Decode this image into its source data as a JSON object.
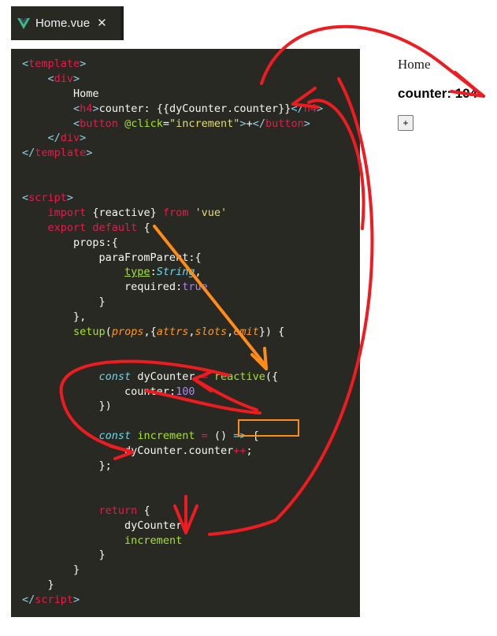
{
  "editor": {
    "tab": {
      "icon": "vue-logo-icon",
      "filename": "Home.vue",
      "close_glyph": "✕"
    },
    "background": "#282923",
    "code_lines": [
      {
        "id": "l1",
        "segments": [
          {
            "t": "<",
            "c": "pun-ang"
          },
          {
            "t": "template",
            "c": "tag"
          },
          {
            "t": ">",
            "c": "pun-ang"
          }
        ]
      },
      {
        "id": "l2",
        "segments": [
          {
            "t": "    ",
            "c": "plain"
          },
          {
            "t": "<",
            "c": "pun-ang"
          },
          {
            "t": "div",
            "c": "tag"
          },
          {
            "t": ">",
            "c": "pun-ang"
          }
        ]
      },
      {
        "id": "l3",
        "segments": [
          {
            "t": "        Home",
            "c": "plain"
          }
        ]
      },
      {
        "id": "l4",
        "segments": [
          {
            "t": "        ",
            "c": "plain"
          },
          {
            "t": "<",
            "c": "pun-ang"
          },
          {
            "t": "h4",
            "c": "tag"
          },
          {
            "t": ">",
            "c": "pun-ang"
          },
          {
            "t": "counter: {{dyCounter.counter}}",
            "c": "plain"
          },
          {
            "t": "</",
            "c": "pun-ang"
          },
          {
            "t": "h4",
            "c": "tag"
          },
          {
            "t": ">",
            "c": "pun-ang"
          }
        ]
      },
      {
        "id": "l5",
        "segments": [
          {
            "t": "        ",
            "c": "plain"
          },
          {
            "t": "<",
            "c": "pun-ang"
          },
          {
            "t": "button",
            "c": "tag"
          },
          {
            "t": " ",
            "c": "plain"
          },
          {
            "t": "@click",
            "c": "attr"
          },
          {
            "t": "=",
            "c": "plain"
          },
          {
            "t": "\"increment\"",
            "c": "str"
          },
          {
            "t": ">",
            "c": "pun-ang"
          },
          {
            "t": "+",
            "c": "plain"
          },
          {
            "t": "</",
            "c": "pun-ang"
          },
          {
            "t": "button",
            "c": "tag"
          },
          {
            "t": ">",
            "c": "pun-ang"
          }
        ]
      },
      {
        "id": "l6",
        "segments": [
          {
            "t": "    ",
            "c": "plain"
          },
          {
            "t": "</",
            "c": "pun-ang"
          },
          {
            "t": "div",
            "c": "tag"
          },
          {
            "t": ">",
            "c": "pun-ang"
          }
        ]
      },
      {
        "id": "l7",
        "segments": [
          {
            "t": "</",
            "c": "pun-ang"
          },
          {
            "t": "template",
            "c": "tag"
          },
          {
            "t": ">",
            "c": "pun-ang"
          }
        ]
      },
      {
        "id": "l8",
        "segments": [
          {
            "t": "",
            "c": "plain"
          }
        ]
      },
      {
        "id": "l9",
        "segments": [
          {
            "t": "",
            "c": "plain"
          }
        ]
      },
      {
        "id": "l10",
        "segments": [
          {
            "t": "<",
            "c": "pun-ang"
          },
          {
            "t": "script",
            "c": "tag"
          },
          {
            "t": ">",
            "c": "pun-ang"
          }
        ]
      },
      {
        "id": "l11",
        "segments": [
          {
            "t": "    ",
            "c": "plain"
          },
          {
            "t": "import",
            "c": "kw"
          },
          {
            "t": " {reactive} ",
            "c": "plain"
          },
          {
            "t": "from",
            "c": "kw"
          },
          {
            "t": " ",
            "c": "plain"
          },
          {
            "t": "'vue'",
            "c": "str"
          }
        ]
      },
      {
        "id": "l12",
        "segments": [
          {
            "t": "    ",
            "c": "plain"
          },
          {
            "t": "export default",
            "c": "kw"
          },
          {
            "t": " {",
            "c": "plain"
          }
        ]
      },
      {
        "id": "l13",
        "segments": [
          {
            "t": "        props:{",
            "c": "plain"
          }
        ]
      },
      {
        "id": "l14",
        "segments": [
          {
            "t": "            paraFromParent:{",
            "c": "plain"
          }
        ]
      },
      {
        "id": "l15",
        "segments": [
          {
            "t": "                ",
            "c": "plain"
          },
          {
            "t": "type",
            "c": "propname"
          },
          {
            "t": ":",
            "c": "plain"
          },
          {
            "t": "String",
            "c": "type"
          },
          {
            "t": ",",
            "c": "plain"
          }
        ]
      },
      {
        "id": "l16",
        "segments": [
          {
            "t": "                required:",
            "c": "plain"
          },
          {
            "t": "true",
            "c": "bool"
          }
        ]
      },
      {
        "id": "l17",
        "segments": [
          {
            "t": "            }",
            "c": "plain"
          }
        ]
      },
      {
        "id": "l18",
        "segments": [
          {
            "t": "        },",
            "c": "plain"
          }
        ]
      },
      {
        "id": "l19",
        "segments": [
          {
            "t": "        ",
            "c": "plain"
          },
          {
            "t": "setup",
            "c": "attr"
          },
          {
            "t": "(",
            "c": "plain"
          },
          {
            "t": "props",
            "c": "param"
          },
          {
            "t": ",{",
            "c": "plain"
          },
          {
            "t": "attrs",
            "c": "param"
          },
          {
            "t": ",",
            "c": "plain"
          },
          {
            "t": "slots",
            "c": "param"
          },
          {
            "t": ",",
            "c": "plain"
          },
          {
            "t": "emit",
            "c": "param"
          },
          {
            "t": "}) {",
            "c": "plain"
          }
        ]
      },
      {
        "id": "l20",
        "segments": [
          {
            "t": "",
            "c": "plain"
          }
        ]
      },
      {
        "id": "l21",
        "segments": [
          {
            "t": "",
            "c": "plain"
          }
        ]
      },
      {
        "id": "l22",
        "segments": [
          {
            "t": "            ",
            "c": "plain"
          },
          {
            "t": "const",
            "c": "ctrl"
          },
          {
            "t": " dyCounter ",
            "c": "plain"
          },
          {
            "t": "=",
            "c": "op"
          },
          {
            "t": " ",
            "c": "plain"
          },
          {
            "t": "reactive",
            "c": "attr"
          },
          {
            "t": "({",
            "c": "plain"
          }
        ]
      },
      {
        "id": "l23",
        "segments": [
          {
            "t": "                counter:",
            "c": "plain"
          },
          {
            "t": "100",
            "c": "num"
          }
        ]
      },
      {
        "id": "l24",
        "segments": [
          {
            "t": "            })",
            "c": "plain"
          }
        ]
      },
      {
        "id": "l25",
        "segments": [
          {
            "t": "",
            "c": "plain"
          }
        ]
      },
      {
        "id": "l26",
        "segments": [
          {
            "t": "            ",
            "c": "plain"
          },
          {
            "t": "const",
            "c": "ctrl"
          },
          {
            "t": " ",
            "c": "plain"
          },
          {
            "t": "increment",
            "c": "attr"
          },
          {
            "t": " ",
            "c": "plain"
          },
          {
            "t": "=",
            "c": "op"
          },
          {
            "t": " () ",
            "c": "plain"
          },
          {
            "t": "=>",
            "c": "type"
          },
          {
            "t": " {",
            "c": "plain"
          }
        ]
      },
      {
        "id": "l27",
        "segments": [
          {
            "t": "                dyCounter.counter",
            "c": "plain"
          },
          {
            "t": "++",
            "c": "op"
          },
          {
            "t": ";",
            "c": "plain"
          }
        ]
      },
      {
        "id": "l28",
        "segments": [
          {
            "t": "            };",
            "c": "plain"
          }
        ]
      },
      {
        "id": "l29",
        "segments": [
          {
            "t": "",
            "c": "plain"
          }
        ]
      },
      {
        "id": "l30",
        "segments": [
          {
            "t": "",
            "c": "plain"
          }
        ]
      },
      {
        "id": "l31",
        "segments": [
          {
            "t": "            ",
            "c": "plain"
          },
          {
            "t": "return",
            "c": "kw"
          },
          {
            "t": " {",
            "c": "plain"
          }
        ]
      },
      {
        "id": "l32",
        "segments": [
          {
            "t": "                dyCounter,",
            "c": "plain"
          }
        ]
      },
      {
        "id": "l33",
        "segments": [
          {
            "t": "                ",
            "c": "plain"
          },
          {
            "t": "increment",
            "c": "attr"
          }
        ]
      },
      {
        "id": "l34",
        "segments": [
          {
            "t": "            }",
            "c": "plain"
          }
        ]
      },
      {
        "id": "l35",
        "segments": [
          {
            "t": "        }",
            "c": "plain"
          }
        ]
      },
      {
        "id": "l36",
        "segments": [
          {
            "t": "    }",
            "c": "plain"
          }
        ]
      },
      {
        "id": "l37",
        "segments": [
          {
            "t": "</",
            "c": "pun-ang"
          },
          {
            "t": "script",
            "c": "tag"
          },
          {
            "t": ">",
            "c": "pun-ang"
          }
        ]
      }
    ]
  },
  "preview": {
    "heading": "Home",
    "counter_label": "counter: 104",
    "counter_value": 104,
    "increment_button_label": "+"
  },
  "annotations": {
    "highlight_color": "#ff8c1a",
    "arrow_color": "#ee1c21",
    "highlighted_token": "reactive"
  }
}
